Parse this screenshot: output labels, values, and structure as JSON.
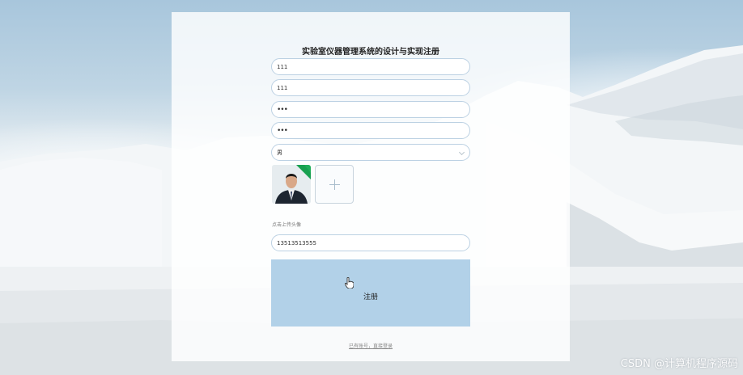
{
  "form": {
    "title": "实验室仪器管理系统的设计与实现注册",
    "username": "111",
    "name": "111",
    "password": "•••",
    "confirm_password": "•••",
    "gender": "男",
    "upload_hint": "点击上传头像",
    "phone": "13513513555",
    "submit_label": "注册",
    "login_link": "已有账号，直接登录"
  },
  "watermark": "CSDN @计算机程序源码",
  "colors": {
    "submit_bg": "#b2d1e8",
    "field_border": "#bcd1e3"
  },
  "icons": {
    "select_arrow": "chevron-down-icon",
    "upload": "plus-icon",
    "cursor": "hand-pointer-icon"
  }
}
